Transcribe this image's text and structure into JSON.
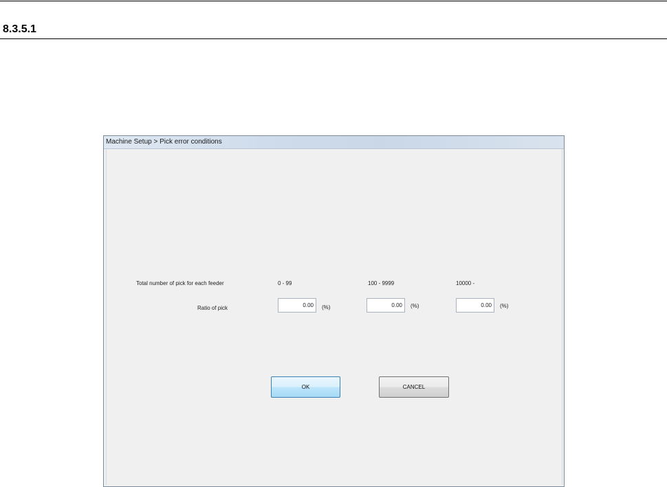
{
  "document": {
    "section_number": "8.3.5.1"
  },
  "window": {
    "title": "Machine Setup > Pick error conditions"
  },
  "form": {
    "row_label_total": "Total number of pick for each feeder",
    "row_label_ratio": "Ratio of pick",
    "ranges": [
      "0 - 99",
      "100 - 9999",
      "10000 -"
    ],
    "ratios": [
      "0.00",
      "0.00",
      "0.00"
    ],
    "unit": "(%)"
  },
  "buttons": {
    "ok_label": "OK",
    "cancel_label": "CANCEL"
  }
}
